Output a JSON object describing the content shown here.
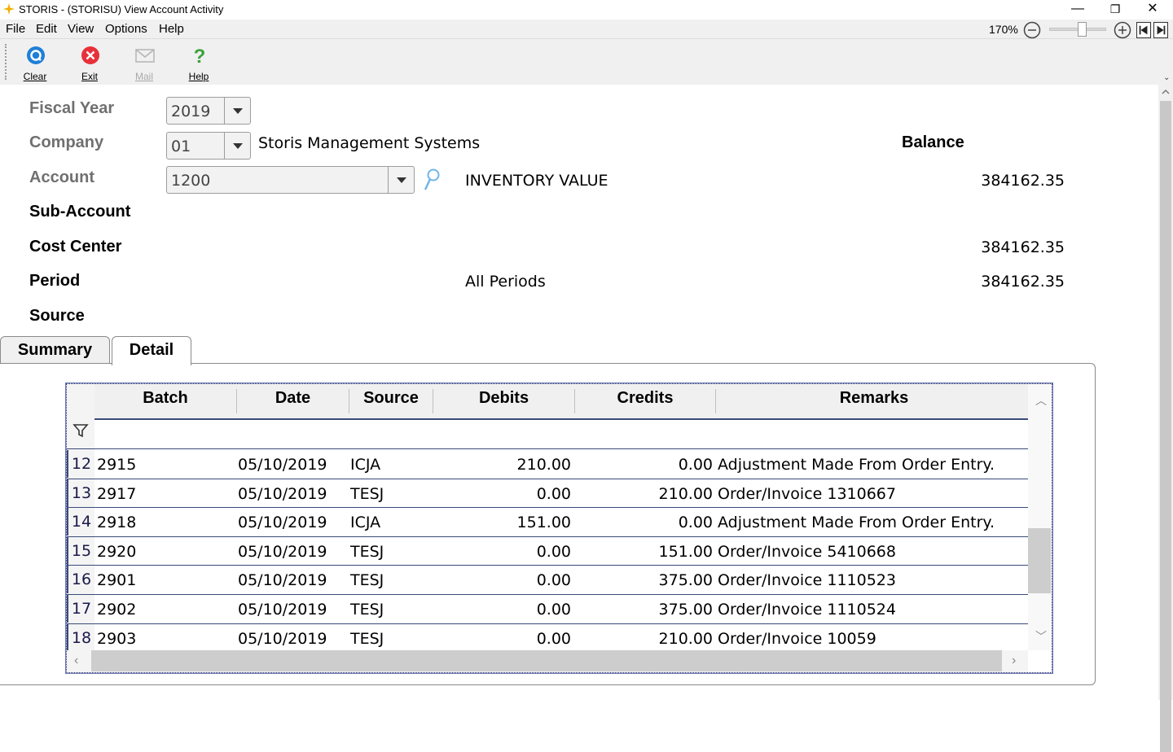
{
  "window": {
    "title": "STORIS - (STORISU) View Account Activity",
    "minimize": "—",
    "restore": "❐",
    "close": "✕"
  },
  "menu": {
    "items": [
      "File",
      "Edit",
      "View",
      "Options",
      "Help"
    ],
    "zoom": "170%"
  },
  "toolbar": {
    "clear": "Clear",
    "exit": "Exit",
    "mail": "Mail",
    "help": "Help"
  },
  "form": {
    "fiscal_year_label": "Fiscal Year",
    "fiscal_year": "2019",
    "company_label": "Company",
    "company": "01",
    "company_name": "Storis Management Systems",
    "balance_label": "Balance",
    "account_label": "Account",
    "account": "1200",
    "account_name": "INVENTORY VALUE",
    "account_balance": "384162.35",
    "subaccount_label": "Sub-Account",
    "cost_center_label": "Cost Center",
    "cost_center_balance": "384162.35",
    "period_label": "Period",
    "period_value": "All Periods",
    "period_balance": "384162.35",
    "source_label": "Source"
  },
  "tabs": {
    "summary": "Summary",
    "detail": "Detail",
    "active": "Detail"
  },
  "grid": {
    "columns": [
      "Batch",
      "Date",
      "Source",
      "Debits",
      "Credits",
      "Remarks"
    ],
    "rows": [
      {
        "n": "12",
        "batch": "2915",
        "date": "05/10/2019",
        "source": "ICJA",
        "debits": "210.00",
        "credits": "0.00",
        "remarks": "Adjustment Made From Order Entry."
      },
      {
        "n": "13",
        "batch": "2917",
        "date": "05/10/2019",
        "source": "TESJ",
        "debits": "0.00",
        "credits": "210.00",
        "remarks": "Order/Invoice 1310667"
      },
      {
        "n": "14",
        "batch": "2918",
        "date": "05/10/2019",
        "source": "ICJA",
        "debits": "151.00",
        "credits": "0.00",
        "remarks": "Adjustment Made From Order Entry."
      },
      {
        "n": "15",
        "batch": "2920",
        "date": "05/10/2019",
        "source": "TESJ",
        "debits": "0.00",
        "credits": "151.00",
        "remarks": "Order/Invoice 5410668"
      },
      {
        "n": "16",
        "batch": "2901",
        "date": "05/10/2019",
        "source": "TESJ",
        "debits": "0.00",
        "credits": "375.00",
        "remarks": "Order/Invoice 1110523"
      },
      {
        "n": "17",
        "batch": "2902",
        "date": "05/10/2019",
        "source": "TESJ",
        "debits": "0.00",
        "credits": "375.00",
        "remarks": "Order/Invoice 1110524"
      },
      {
        "n": "18",
        "batch": "2903",
        "date": "05/10/2019",
        "source": "TESJ",
        "debits": "0.00",
        "credits": "210.00",
        "remarks": "Order/Invoice 10059"
      }
    ]
  }
}
